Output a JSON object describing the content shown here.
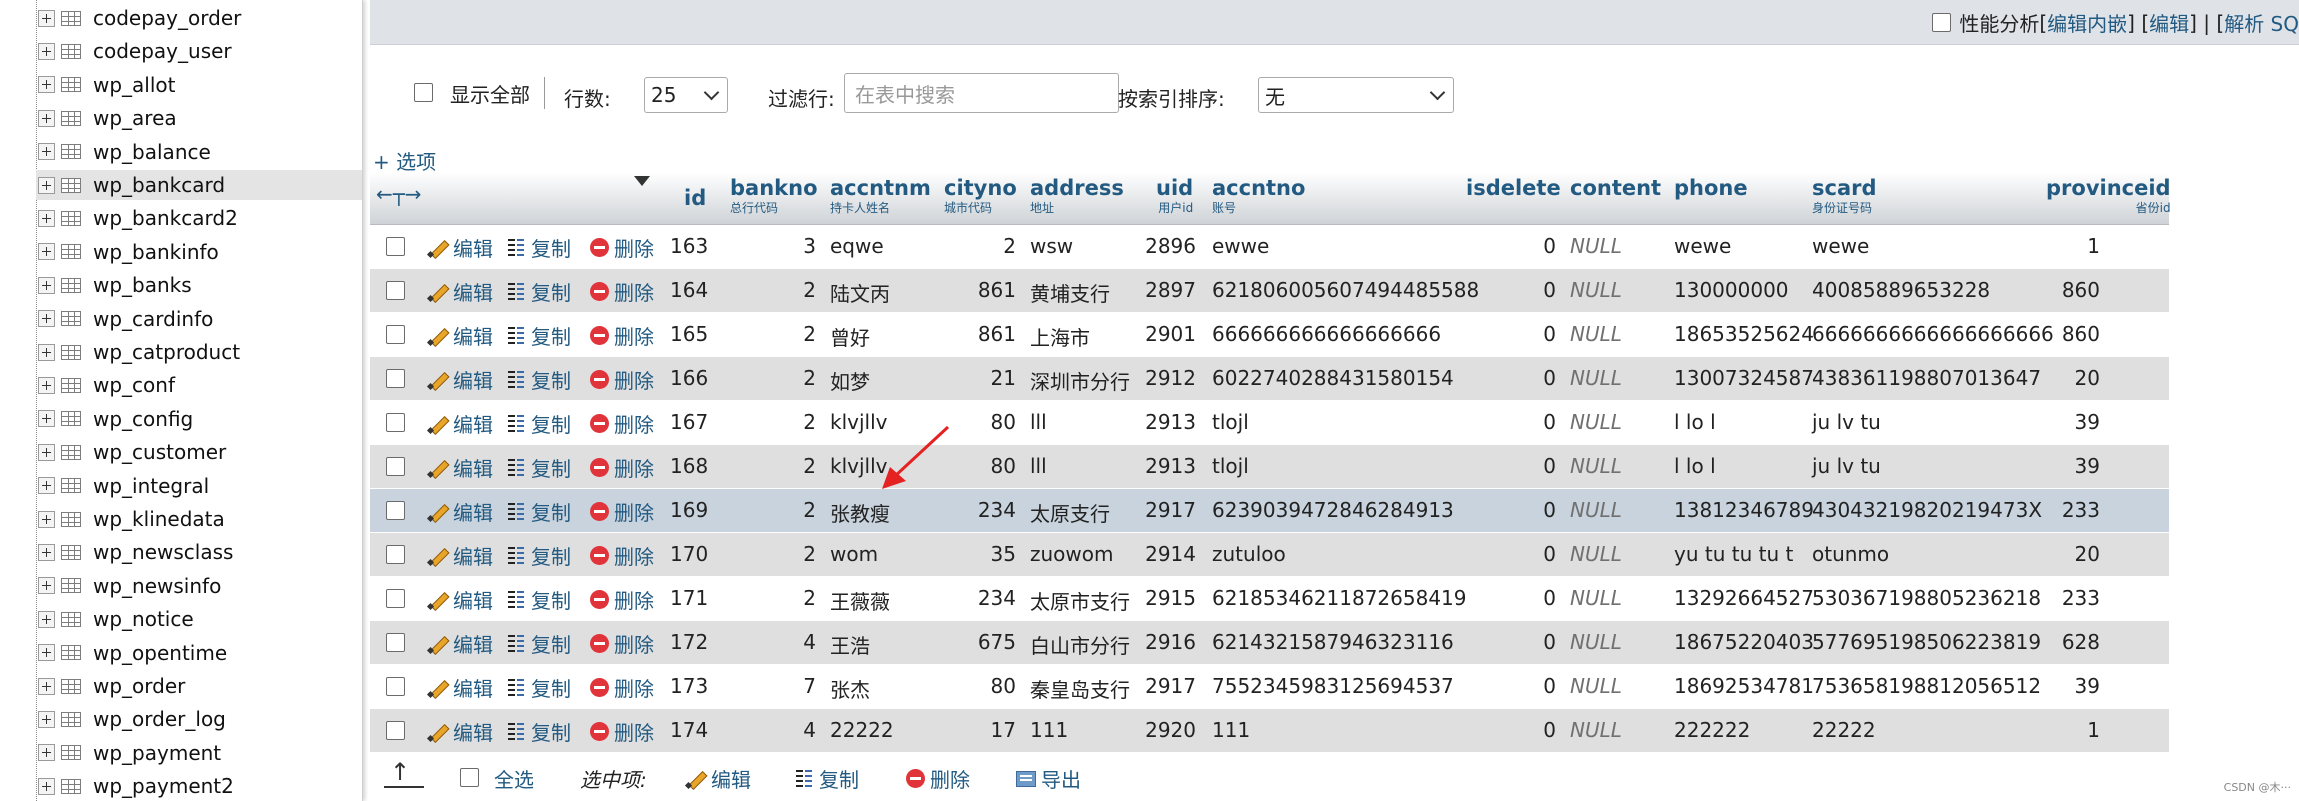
{
  "nav": {
    "items": [
      {
        "label": "codepay_order"
      },
      {
        "label": "codepay_user"
      },
      {
        "label": "wp_allot"
      },
      {
        "label": "wp_area"
      },
      {
        "label": "wp_balance"
      },
      {
        "label": "wp_bankcard",
        "selected": true
      },
      {
        "label": "wp_bankcard2"
      },
      {
        "label": "wp_bankinfo"
      },
      {
        "label": "wp_banks"
      },
      {
        "label": "wp_cardinfo"
      },
      {
        "label": "wp_catproduct"
      },
      {
        "label": "wp_conf"
      },
      {
        "label": "wp_config"
      },
      {
        "label": "wp_customer"
      },
      {
        "label": "wp_integral"
      },
      {
        "label": "wp_klinedata"
      },
      {
        "label": "wp_newsclass"
      },
      {
        "label": "wp_newsinfo"
      },
      {
        "label": "wp_notice"
      },
      {
        "label": "wp_opentime"
      },
      {
        "label": "wp_order"
      },
      {
        "label": "wp_order_log"
      },
      {
        "label": "wp_payment"
      },
      {
        "label": "wp_payment2"
      }
    ]
  },
  "topbar": {
    "profiling_label": "性能分析",
    "link_bracket_open": "[",
    "edit_inline": "编辑内嵌",
    "edit": "编辑",
    "explain": "解析 SQ",
    "sep1": "] [",
    "sep2": "] |",
    "space": " "
  },
  "controls": {
    "show_all_label": "显示全部",
    "rows_label": "行数:",
    "rows_value": "25",
    "filter_label": "过滤行:",
    "filter_placeholder": "在表中搜索",
    "sort_label": "按索引排序:",
    "sort_value": "无"
  },
  "options_link": "+ 选项",
  "table": {
    "columns": [
      {
        "name": "id",
        "sub": ""
      },
      {
        "name": "bankno",
        "sub": "总行代码"
      },
      {
        "name": "accntnm",
        "sub": "持卡人姓名"
      },
      {
        "name": "cityno",
        "sub": "城市代码"
      },
      {
        "name": "address",
        "sub": "地址"
      },
      {
        "name": "uid",
        "sub": "用户id"
      },
      {
        "name": "accntno",
        "sub": "账号"
      },
      {
        "name": "isdelete",
        "sub": ""
      },
      {
        "name": "content",
        "sub": ""
      },
      {
        "name": "phone",
        "sub": ""
      },
      {
        "name": "scard",
        "sub": "身份证号码"
      },
      {
        "name": "provinceid",
        "sub": "省份id"
      }
    ],
    "actions": {
      "edit": "编辑",
      "copy": "复制",
      "delete": "删除"
    },
    "rows": [
      {
        "id": "163",
        "bankno": "3",
        "accntnm": "eqwe",
        "cityno": "2",
        "address": "wsw",
        "uid": "2896",
        "accntno": "ewwe",
        "isdelete": "0",
        "content": "NULL",
        "phone": "wewe",
        "scard": "wewe",
        "provinceid": "1"
      },
      {
        "id": "164",
        "bankno": "2",
        "accntnm": "陆文丙",
        "cityno": "861",
        "address": "黄埔支行",
        "uid": "2897",
        "accntno": "621806005607494485588",
        "isdelete": "0",
        "content": "NULL",
        "phone": "130000000",
        "scard": "40085889653228",
        "provinceid": "860"
      },
      {
        "id": "165",
        "bankno": "2",
        "accntnm": "曾好",
        "cityno": "861",
        "address": "上海市",
        "uid": "2901",
        "accntno": "666666666666666666",
        "isdelete": "0",
        "content": "NULL",
        "phone": "18653525624",
        "scard": "6666666666666666666",
        "provinceid": "860"
      },
      {
        "id": "166",
        "bankno": "2",
        "accntnm": "如梦",
        "cityno": "21",
        "address": "深圳市分行",
        "uid": "2912",
        "accntno": "6022740288431580154",
        "isdelete": "0",
        "content": "NULL",
        "phone": "13007324587",
        "scard": "438361198807013647",
        "provinceid": "20"
      },
      {
        "id": "167",
        "bankno": "2",
        "accntnm": "klvjllv",
        "cityno": "80",
        "address": "lll",
        "uid": "2913",
        "accntno": "tlojl",
        "isdelete": "0",
        "content": "NULL",
        "phone": "l lo l",
        "scard": "ju lv tu",
        "provinceid": "39"
      },
      {
        "id": "168",
        "bankno": "2",
        "accntnm": "klvjllv",
        "cityno": "80",
        "address": "lll",
        "uid": "2913",
        "accntno": "tlojl",
        "isdelete": "0",
        "content": "NULL",
        "phone": "l lo l",
        "scard": "ju lv tu",
        "provinceid": "39"
      },
      {
        "id": "169",
        "bankno": "2",
        "accntnm": "张教瘦",
        "cityno": "234",
        "address": "太原支行",
        "uid": "2917",
        "accntno": "6239039472846284913",
        "isdelete": "0",
        "content": "NULL",
        "phone": "13812346789",
        "scard": "43043219820219473X",
        "provinceid": "233"
      },
      {
        "id": "170",
        "bankno": "2",
        "accntnm": "wom",
        "cityno": "35",
        "address": "zuowom",
        "uid": "2914",
        "accntno": "zutuloo",
        "isdelete": "0",
        "content": "NULL",
        "phone": "yu tu tu tu t",
        "scard": "otunmo",
        "provinceid": "20"
      },
      {
        "id": "171",
        "bankno": "2",
        "accntnm": "王薇薇",
        "cityno": "234",
        "address": "太原市支行",
        "uid": "2915",
        "accntno": "62185346211872658419",
        "isdelete": "0",
        "content": "NULL",
        "phone": "13292664527",
        "scard": "530367198805236218",
        "provinceid": "233"
      },
      {
        "id": "172",
        "bankno": "4",
        "accntnm": "王浩",
        "cityno": "675",
        "address": "白山市分行",
        "uid": "2916",
        "accntno": "6214321587946323116",
        "isdelete": "0",
        "content": "NULL",
        "phone": "18675220403",
        "scard": "577695198506223819",
        "provinceid": "628"
      },
      {
        "id": "173",
        "bankno": "7",
        "accntnm": "张杰",
        "cityno": "80",
        "address": "秦皇岛支行",
        "uid": "2917",
        "accntno": "7552345983125694537",
        "isdelete": "0",
        "content": "NULL",
        "phone": "18692534781",
        "scard": "753658198812056512",
        "provinceid": "39"
      },
      {
        "id": "174",
        "bankno": "4",
        "accntnm": "22222",
        "cityno": "17",
        "address": "111",
        "uid": "2920",
        "accntno": "111",
        "isdelete": "0",
        "content": "NULL",
        "phone": "222222",
        "scard": "22222",
        "provinceid": "1"
      }
    ]
  },
  "footer": {
    "select_all": "全选",
    "selected_items": "选中项:",
    "edit": "编辑",
    "copy": "复制",
    "delete": "删除",
    "export": "导出"
  },
  "watermark": "CSDN @木···"
}
